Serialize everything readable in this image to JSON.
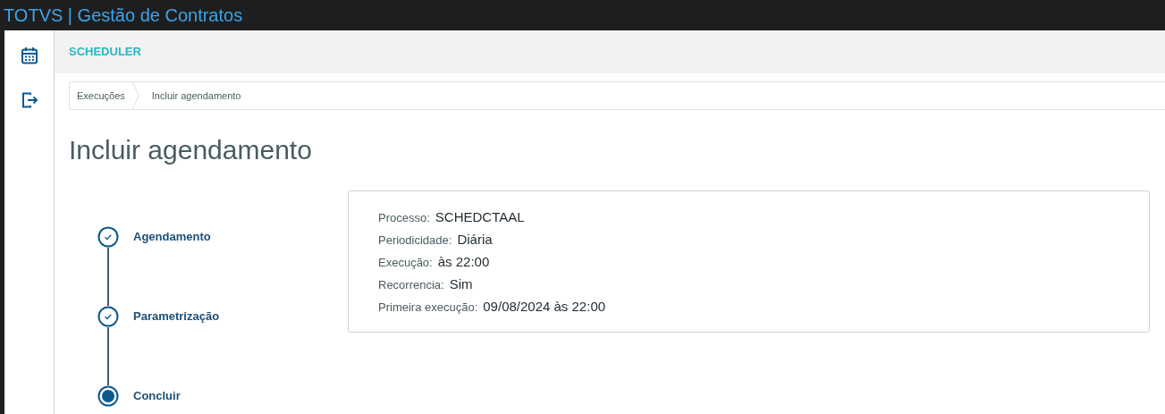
{
  "window": {
    "title": "TOTVS | Gestão de Contratos"
  },
  "sidebar": {
    "items": [
      {
        "kind": "calendar"
      },
      {
        "kind": "logout"
      }
    ]
  },
  "header": {
    "title": "SCHEDULER"
  },
  "breadcrumb": [
    "Execuções",
    "Incluir agendamento"
  ],
  "page_title": "Incluir agendamento",
  "stepper": [
    {
      "label": "Agendamento",
      "kind": "done"
    },
    {
      "label": "Parametrização",
      "kind": "done"
    },
    {
      "label": "Concluir",
      "kind": "current"
    }
  ],
  "summary": [
    {
      "label": "Processo:",
      "value": "SCHEDCTAAL"
    },
    {
      "label": "Periodicidade:",
      "value": "Diária"
    },
    {
      "label": "Execução:",
      "value": "às 22:00"
    },
    {
      "label": "Recorrencia:",
      "value": "Sim"
    },
    {
      "label": "Primeira execução:",
      "value": "09/08/2024 às 22:00"
    }
  ]
}
